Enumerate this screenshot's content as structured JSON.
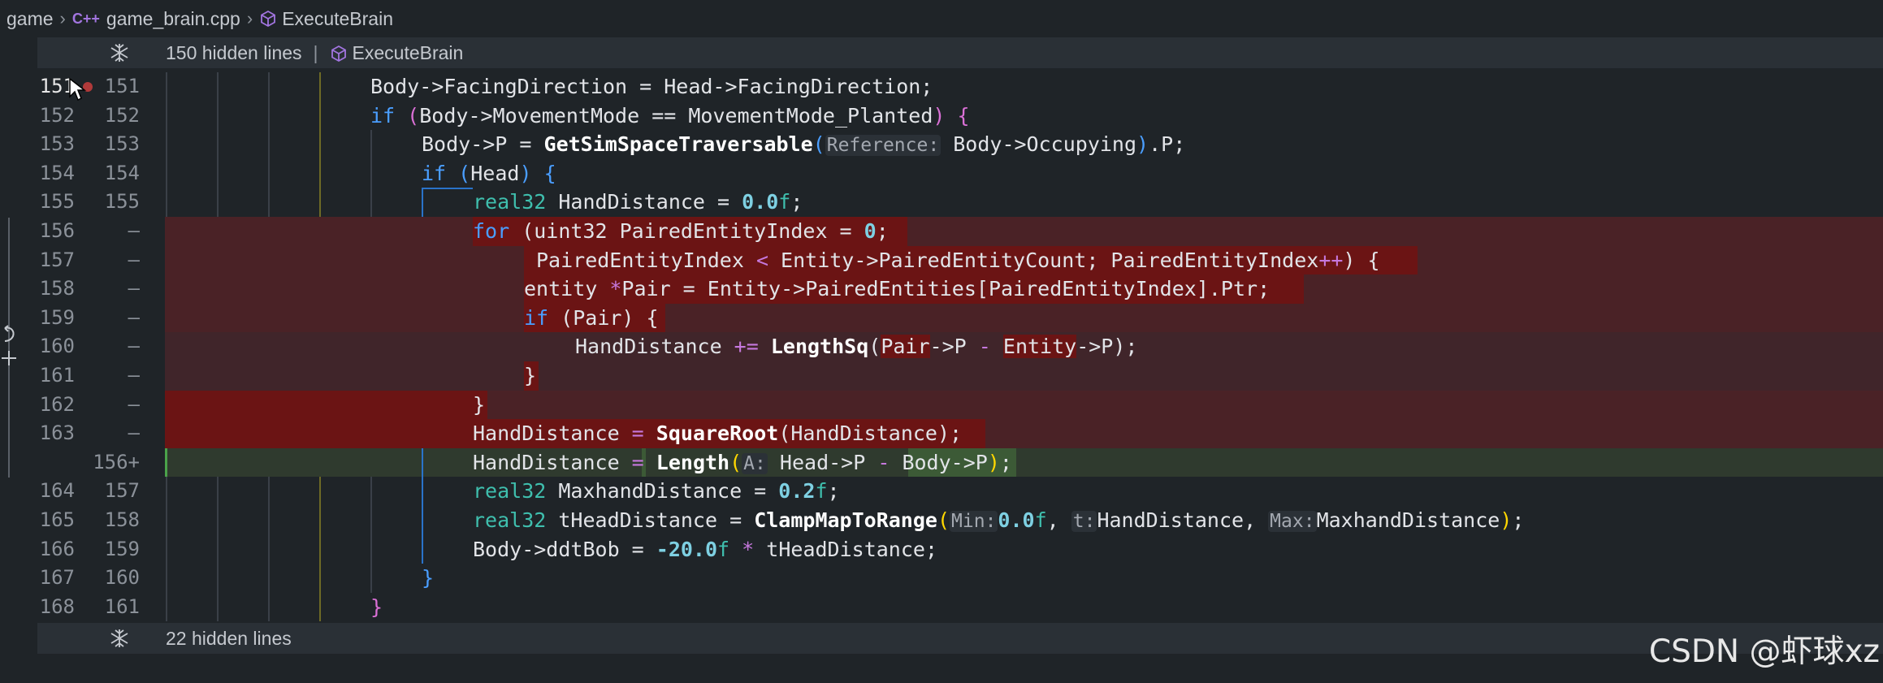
{
  "breadcrumb": {
    "folder": "game",
    "file_badge": "C++",
    "file": "game_brain.cpp",
    "symbol": "ExecuteBrain"
  },
  "fold_top": {
    "text": "150 hidden lines",
    "symbol": "ExecuteBrain"
  },
  "fold_bottom": {
    "text": "22 hidden lines"
  },
  "lines": [
    {
      "old": "151",
      "new": "151"
    },
    {
      "old": "152",
      "new": "152"
    },
    {
      "old": "153",
      "new": "153"
    },
    {
      "old": "154",
      "new": "154"
    },
    {
      "old": "155",
      "new": "155"
    },
    {
      "old": "156",
      "new": "—"
    },
    {
      "old": "157",
      "new": "—"
    },
    {
      "old": "158",
      "new": "—"
    },
    {
      "old": "159",
      "new": "—"
    },
    {
      "old": "160",
      "new": "—"
    },
    {
      "old": "161",
      "new": "—"
    },
    {
      "old": "162",
      "new": "—"
    },
    {
      "old": "163",
      "new": "—"
    },
    {
      "old": "",
      "new": "156+"
    },
    {
      "old": "164",
      "new": "157"
    },
    {
      "old": "165",
      "new": "158"
    },
    {
      "old": "166",
      "new": "159"
    },
    {
      "old": "167",
      "new": "160"
    },
    {
      "old": "168",
      "new": "161"
    }
  ],
  "hints": {
    "reference": "Reference:",
    "a": "A:",
    "min": "Min:",
    "t": "t:",
    "max": "Max:"
  },
  "watermark": "CSDN @虾球xz",
  "colors": {
    "removed_line": "#4a2226",
    "removed_highlight": "#6b1414",
    "added_line": "#2f3a2e",
    "keyword": "#4a9eff",
    "type": "#3fbfae",
    "number": "#7ed0e2"
  }
}
